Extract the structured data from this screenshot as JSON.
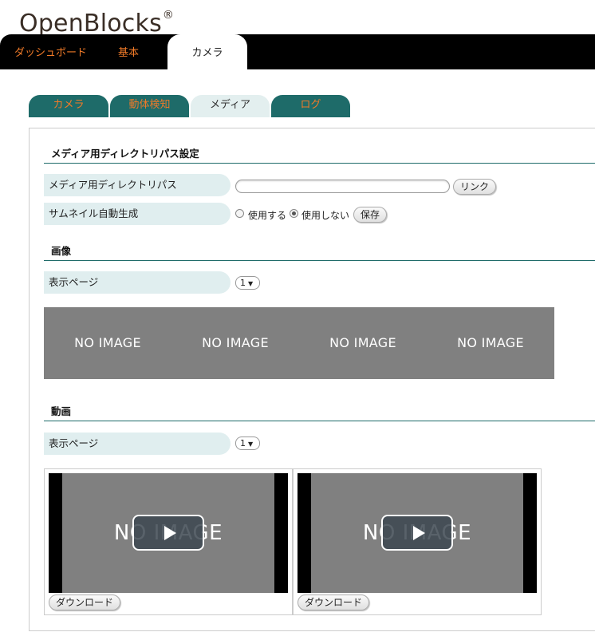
{
  "brand": {
    "name": "OpenBlocks",
    "mark": "®"
  },
  "top_nav": [
    {
      "label": "ダッシュボード"
    },
    {
      "label": "基本"
    },
    {
      "label": "カメラ",
      "active": true
    }
  ],
  "sub_tabs": [
    {
      "label": "カメラ"
    },
    {
      "label": "動体検知"
    },
    {
      "label": "メディア",
      "active": true
    },
    {
      "label": "ログ"
    }
  ],
  "media_dir": {
    "title": "メディア用ディレクトリパス設定",
    "path_label": "メディア用ディレクトリパス",
    "path_value": "",
    "link_button": "リンク",
    "thumb_label": "サムネイル自動生成",
    "thumb_options": [
      {
        "label": "使用する",
        "checked": false
      },
      {
        "label": "使用しない",
        "checked": true
      }
    ],
    "save_button": "保存"
  },
  "images": {
    "title": "画像",
    "page_label": "表示ページ",
    "page_value": "1",
    "items": [
      "NO IMAGE",
      "NO IMAGE",
      "NO IMAGE",
      "NO IMAGE"
    ]
  },
  "videos": {
    "title": "動画",
    "page_label": "表示ページ",
    "page_value": "1",
    "items": [
      {
        "placeholder": "NO IMAGE",
        "download": "ダウンロード"
      },
      {
        "placeholder": "NO IMAGE",
        "download": "ダウンロード"
      }
    ]
  },
  "colors": {
    "accent_orange": "#f07a28",
    "tab_teal": "#1e6b69",
    "label_bg": "#e0eeef",
    "placeholder_gray": "#808080"
  }
}
